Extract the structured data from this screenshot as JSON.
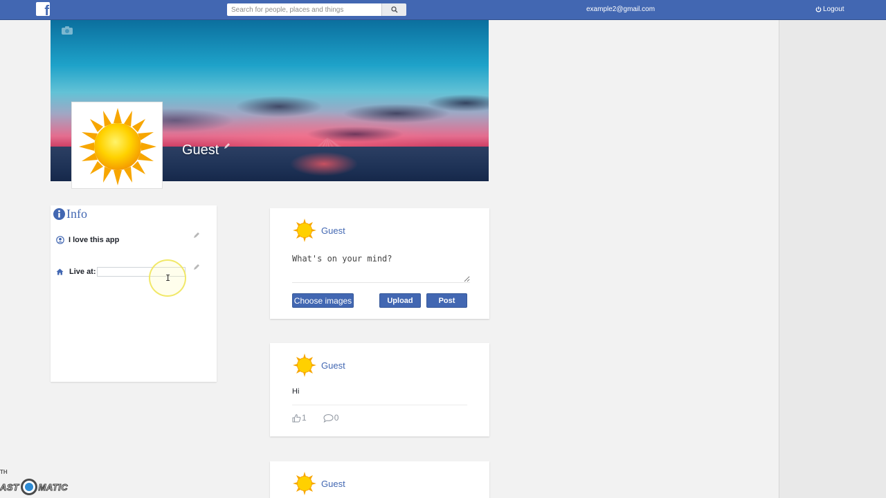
{
  "topbar": {
    "logo_letter": "f",
    "search_placeholder": "Search for people, places and things",
    "user_email": "example2@gmail.com",
    "logout_label": "Logout"
  },
  "profile": {
    "name": "Guest"
  },
  "info": {
    "title": "Info",
    "bio": "I love this app",
    "live_at_label": "Live at:",
    "live_at_value": ""
  },
  "composer": {
    "author": "Guest",
    "placeholder": "What's on your mind?",
    "choose_images_label": "Choose images",
    "upload_label": "Upload",
    "post_label": "Post"
  },
  "posts": [
    {
      "author": "Guest",
      "body": "Hi",
      "likes": "1",
      "comments": "0"
    },
    {
      "author": "Guest"
    }
  ],
  "watermark": {
    "small": "TH",
    "brand_left": "AST",
    "brand_right": "MATIC"
  },
  "colors": {
    "brand": "#4267b2",
    "page_bg": "#f2f2f2"
  }
}
